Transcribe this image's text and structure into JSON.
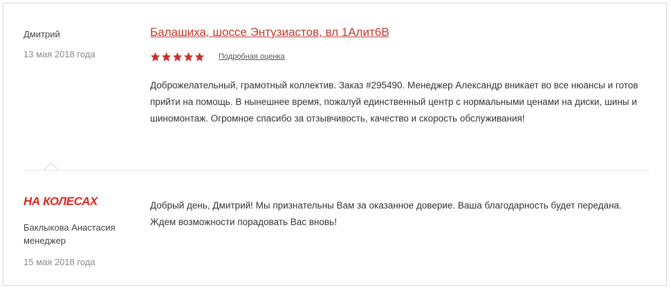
{
  "review": {
    "author": "Дмитрий",
    "date": "13 мая 2018 года",
    "location_link": "Балашиха, шоссе Энтузиастов, вл 1Алит6В",
    "rating": 5,
    "rating_max": 5,
    "detail_link": "Подробная оценка",
    "text": "Доброжелательный, грамотный коллектив. Заказ #295490. Менеджер Александр вникает во все нюансы и готов прийти на помощь. В нынешнее время, пожалуй единственный центр с нормальными ценами на диски, шины и шиномонтаж. Огромное спасибо за отзывчивость, качество и скорость обслуживания!"
  },
  "reply": {
    "logo_text": "НА КОЛЕСАХ",
    "author": "Баклыкова Анастасия",
    "role": "менеджер",
    "date": "15 мая 2018 года",
    "text": "Добрый день, Дмитрий! Мы признательны Вам за оказанное доверие. Ваша благодарность будет передана. Ждем возможности порадовать Вас вновь!"
  },
  "colors": {
    "accent": "#c0392b",
    "star": "#c9302c",
    "muted_text": "#8a8a8a",
    "border": "#d9d9d9"
  },
  "icons": {
    "star": "star-icon",
    "logo": "na-kolesah-logo"
  }
}
